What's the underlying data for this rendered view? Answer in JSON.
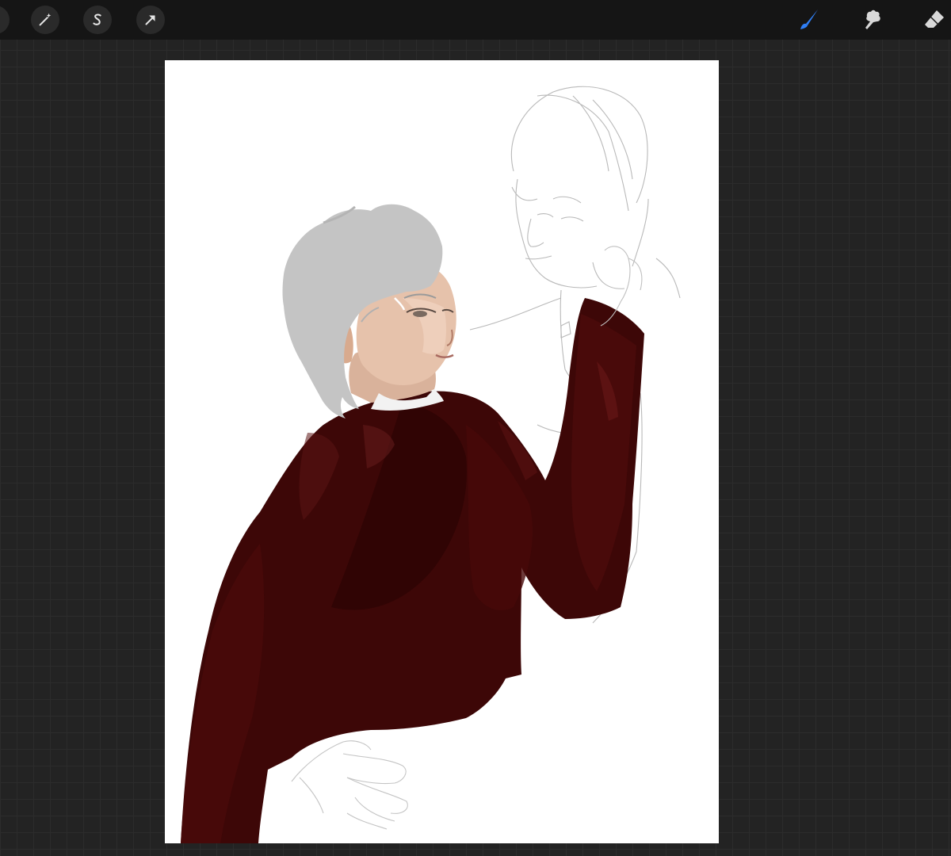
{
  "app": {
    "toolbar_left": [
      {
        "name": "actions-wrench-icon"
      },
      {
        "name": "adjustments-magic-wand-icon"
      },
      {
        "name": "selection-s-icon"
      },
      {
        "name": "transform-arrow-icon"
      }
    ],
    "toolbar_right": [
      {
        "name": "brush-icon",
        "active": true
      },
      {
        "name": "smudge-icon",
        "active": false
      },
      {
        "name": "eraser-icon",
        "active": false
      }
    ],
    "colors": {
      "active_tool": "#2f7ff6",
      "toolbar_bg": "#151515",
      "workspace_bg": "#232323",
      "jacket": "#3d0707",
      "hair": "#c4c4c4",
      "skin": "#e6c2ab"
    }
  }
}
